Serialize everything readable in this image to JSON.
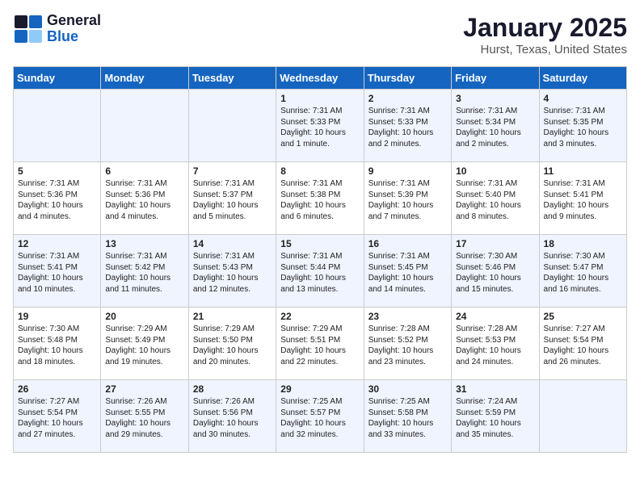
{
  "header": {
    "logo_general": "General",
    "logo_blue": "Blue",
    "title": "January 2025",
    "subtitle": "Hurst, Texas, United States"
  },
  "days_of_week": [
    "Sunday",
    "Monday",
    "Tuesday",
    "Wednesday",
    "Thursday",
    "Friday",
    "Saturday"
  ],
  "weeks": [
    [
      {
        "day": "",
        "info": ""
      },
      {
        "day": "",
        "info": ""
      },
      {
        "day": "",
        "info": ""
      },
      {
        "day": "1",
        "info": "Sunrise: 7:31 AM\nSunset: 5:33 PM\nDaylight: 10 hours\nand 1 minute."
      },
      {
        "day": "2",
        "info": "Sunrise: 7:31 AM\nSunset: 5:33 PM\nDaylight: 10 hours\nand 2 minutes."
      },
      {
        "day": "3",
        "info": "Sunrise: 7:31 AM\nSunset: 5:34 PM\nDaylight: 10 hours\nand 2 minutes."
      },
      {
        "day": "4",
        "info": "Sunrise: 7:31 AM\nSunset: 5:35 PM\nDaylight: 10 hours\nand 3 minutes."
      }
    ],
    [
      {
        "day": "5",
        "info": "Sunrise: 7:31 AM\nSunset: 5:36 PM\nDaylight: 10 hours\nand 4 minutes."
      },
      {
        "day": "6",
        "info": "Sunrise: 7:31 AM\nSunset: 5:36 PM\nDaylight: 10 hours\nand 4 minutes."
      },
      {
        "day": "7",
        "info": "Sunrise: 7:31 AM\nSunset: 5:37 PM\nDaylight: 10 hours\nand 5 minutes."
      },
      {
        "day": "8",
        "info": "Sunrise: 7:31 AM\nSunset: 5:38 PM\nDaylight: 10 hours\nand 6 minutes."
      },
      {
        "day": "9",
        "info": "Sunrise: 7:31 AM\nSunset: 5:39 PM\nDaylight: 10 hours\nand 7 minutes."
      },
      {
        "day": "10",
        "info": "Sunrise: 7:31 AM\nSunset: 5:40 PM\nDaylight: 10 hours\nand 8 minutes."
      },
      {
        "day": "11",
        "info": "Sunrise: 7:31 AM\nSunset: 5:41 PM\nDaylight: 10 hours\nand 9 minutes."
      }
    ],
    [
      {
        "day": "12",
        "info": "Sunrise: 7:31 AM\nSunset: 5:41 PM\nDaylight: 10 hours\nand 10 minutes."
      },
      {
        "day": "13",
        "info": "Sunrise: 7:31 AM\nSunset: 5:42 PM\nDaylight: 10 hours\nand 11 minutes."
      },
      {
        "day": "14",
        "info": "Sunrise: 7:31 AM\nSunset: 5:43 PM\nDaylight: 10 hours\nand 12 minutes."
      },
      {
        "day": "15",
        "info": "Sunrise: 7:31 AM\nSunset: 5:44 PM\nDaylight: 10 hours\nand 13 minutes."
      },
      {
        "day": "16",
        "info": "Sunrise: 7:31 AM\nSunset: 5:45 PM\nDaylight: 10 hours\nand 14 minutes."
      },
      {
        "day": "17",
        "info": "Sunrise: 7:30 AM\nSunset: 5:46 PM\nDaylight: 10 hours\nand 15 minutes."
      },
      {
        "day": "18",
        "info": "Sunrise: 7:30 AM\nSunset: 5:47 PM\nDaylight: 10 hours\nand 16 minutes."
      }
    ],
    [
      {
        "day": "19",
        "info": "Sunrise: 7:30 AM\nSunset: 5:48 PM\nDaylight: 10 hours\nand 18 minutes."
      },
      {
        "day": "20",
        "info": "Sunrise: 7:29 AM\nSunset: 5:49 PM\nDaylight: 10 hours\nand 19 minutes."
      },
      {
        "day": "21",
        "info": "Sunrise: 7:29 AM\nSunset: 5:50 PM\nDaylight: 10 hours\nand 20 minutes."
      },
      {
        "day": "22",
        "info": "Sunrise: 7:29 AM\nSunset: 5:51 PM\nDaylight: 10 hours\nand 22 minutes."
      },
      {
        "day": "23",
        "info": "Sunrise: 7:28 AM\nSunset: 5:52 PM\nDaylight: 10 hours\nand 23 minutes."
      },
      {
        "day": "24",
        "info": "Sunrise: 7:28 AM\nSunset: 5:53 PM\nDaylight: 10 hours\nand 24 minutes."
      },
      {
        "day": "25",
        "info": "Sunrise: 7:27 AM\nSunset: 5:54 PM\nDaylight: 10 hours\nand 26 minutes."
      }
    ],
    [
      {
        "day": "26",
        "info": "Sunrise: 7:27 AM\nSunset: 5:54 PM\nDaylight: 10 hours\nand 27 minutes."
      },
      {
        "day": "27",
        "info": "Sunrise: 7:26 AM\nSunset: 5:55 PM\nDaylight: 10 hours\nand 29 minutes."
      },
      {
        "day": "28",
        "info": "Sunrise: 7:26 AM\nSunset: 5:56 PM\nDaylight: 10 hours\nand 30 minutes."
      },
      {
        "day": "29",
        "info": "Sunrise: 7:25 AM\nSunset: 5:57 PM\nDaylight: 10 hours\nand 32 minutes."
      },
      {
        "day": "30",
        "info": "Sunrise: 7:25 AM\nSunset: 5:58 PM\nDaylight: 10 hours\nand 33 minutes."
      },
      {
        "day": "31",
        "info": "Sunrise: 7:24 AM\nSunset: 5:59 PM\nDaylight: 10 hours\nand 35 minutes."
      },
      {
        "day": "",
        "info": ""
      }
    ]
  ]
}
